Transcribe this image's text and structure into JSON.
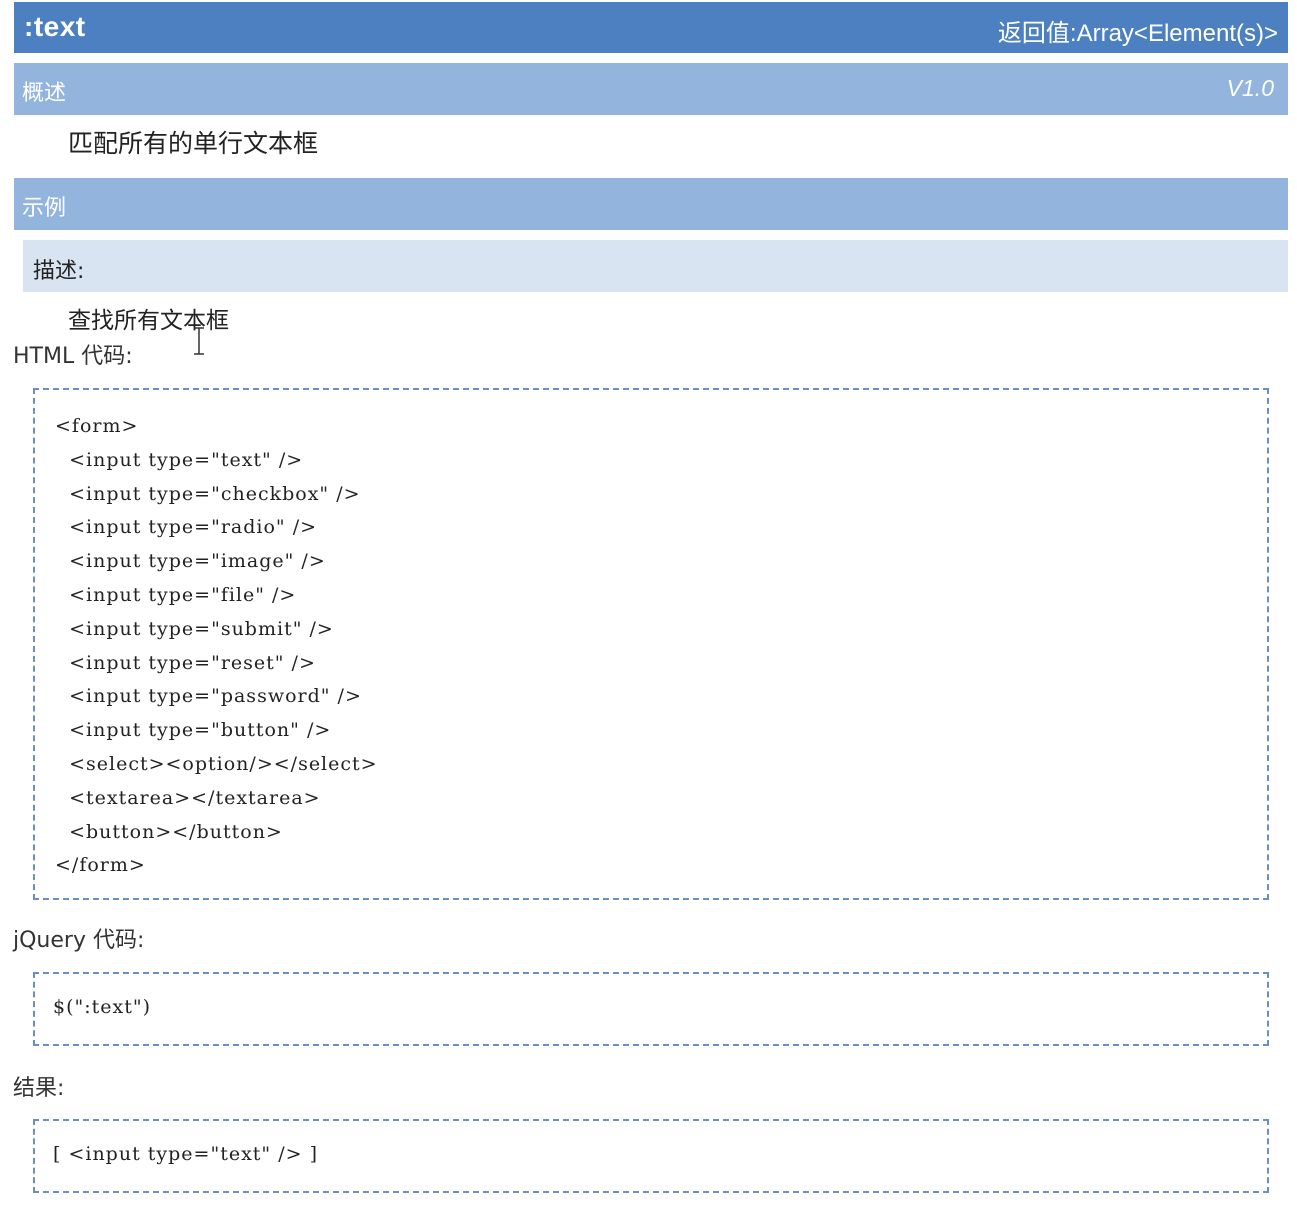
{
  "header": {
    "selector": ":text",
    "return_value": "返回值:Array<Element(s)>"
  },
  "overview": {
    "label": "概述",
    "version": "V1.0",
    "description": "匹配所有的单行文本框"
  },
  "example": {
    "label": "示例",
    "desc_label": "描述:",
    "desc_text": "查找所有文本框",
    "html_label": "HTML 代码:",
    "html_code": [
      "<form>",
      "  <input type=\"text\" />",
      "  <input type=\"checkbox\" />",
      "  <input type=\"radio\" />",
      "  <input type=\"image\" />",
      "  <input type=\"file\" />",
      "  <input type=\"submit\" />",
      "  <input type=\"reset\" />",
      "  <input type=\"password\" />",
      "  <input type=\"button\" />",
      "  <select><option/></select>",
      "  <textarea></textarea>",
      "  <button></button>",
      "</form>"
    ],
    "jquery_label": "jQuery 代码:",
    "jquery_code": "$(\":text\")",
    "result_label": "结果:",
    "result_code": "[ <input type=\"text\" /> ]"
  },
  "icons": {
    "cursor": "text-cursor-icon"
  }
}
